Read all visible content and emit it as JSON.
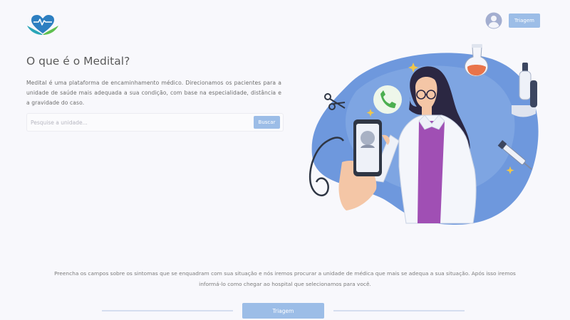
{
  "header": {
    "triage_label": "Triagem"
  },
  "main": {
    "title": "O que é o Medital?",
    "description": "Medital é uma plataforma de encaminhamento médico. Direcionamos os pacientes para a unidade de saúde mais adequada a sua condição, com base na especialidade, distância e a gravidade do caso.",
    "search": {
      "placeholder": "Pesquise a unidade...",
      "value": "",
      "button_label": "Buscar"
    }
  },
  "footer": {
    "instructions_line1": "Preencha os campos sobre os sintomas que se enquadram com sua situação e nós iremos procurar a unidade de médica que mais se adequa a sua situação. Após isso iremos",
    "instructions_line2": "informá-lo como chegar ao hospital que selecionamos para você.",
    "triage_button_label": "Triagem"
  },
  "colors": {
    "accent": "#9cbde7",
    "logo_blue": "#2d7fc1",
    "logo_green": "#5fbf4f",
    "illustration_blue": "#6e98dd",
    "coat_purple": "#a04fb4"
  },
  "icons": {
    "logo": "heart-hands-logo",
    "avatar": "user-avatar-icon"
  }
}
